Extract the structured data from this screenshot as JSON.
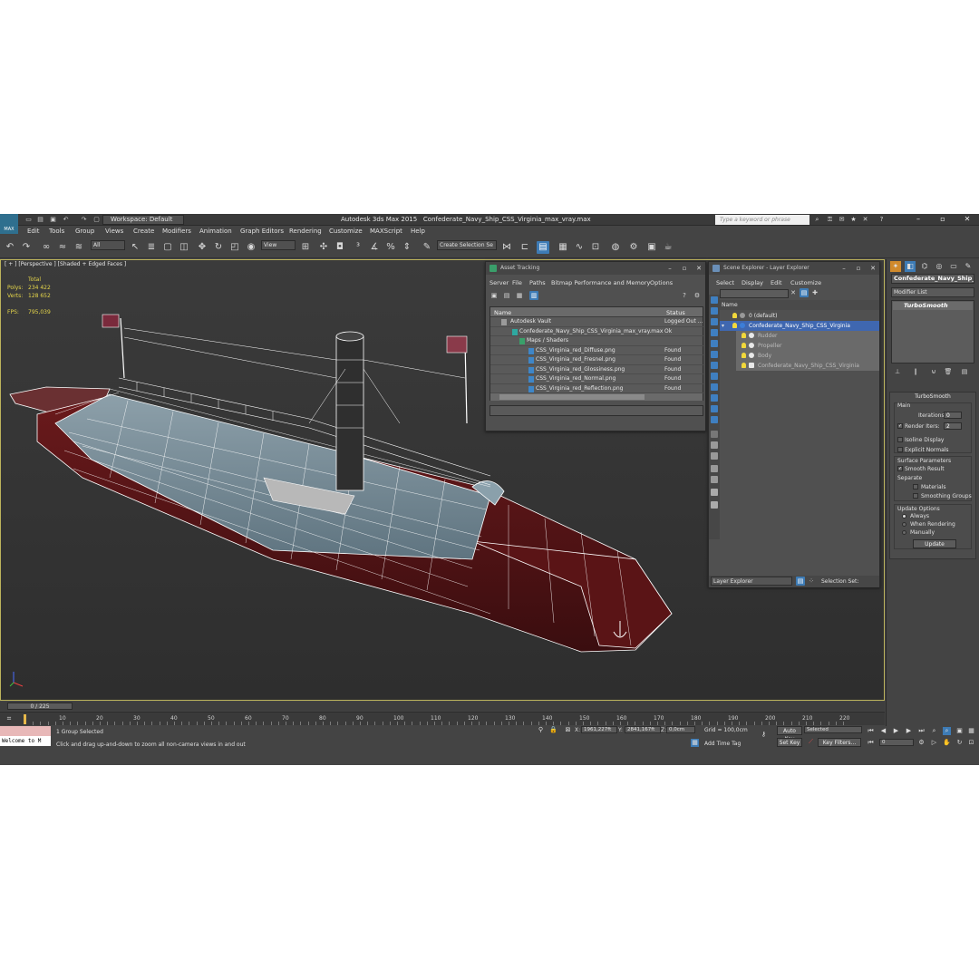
{
  "titlebar": {
    "workspace": "Workspace: Default",
    "app": "Autodesk 3ds Max  2015",
    "file": "Confederate_Navy_Ship_CSS_Virginia_max_vray.max",
    "search_placeholder": "Type a keyword or phrase"
  },
  "menu": [
    "Edit",
    "Tools",
    "Group",
    "Views",
    "Create",
    "Modifiers",
    "Animation",
    "Graph Editors",
    "Rendering",
    "Customize",
    "MAXScript",
    "Help"
  ],
  "toolbar": {
    "filter": "All",
    "ref_coord": "View",
    "selection_set": "Create Selection Se"
  },
  "viewport": {
    "label": "[ + ] [Perspective ] [Shaded + Edged Faces ]",
    "stats_header": "Total",
    "polys_label": "Polys:",
    "polys": "234 422",
    "verts_label": "Verts:",
    "verts": "128 652",
    "fps_label": "FPS:",
    "fps": "795,039"
  },
  "asset_tracking": {
    "title": "Asset Tracking",
    "menu": [
      "Server",
      "File",
      "Paths",
      "Bitmap Performance and Memory",
      "Options"
    ],
    "col_name": "Name",
    "col_status": "Status",
    "rows": [
      {
        "name": "Autodesk Vault",
        "status": "Logged Out ..."
      },
      {
        "name": "Confederate_Navy_Ship_CSS_Virginia_max_vray.max",
        "status": "Ok"
      },
      {
        "name": "Maps / Shaders",
        "status": ""
      },
      {
        "name": "CSS_Virginia_red_Diffuse.png",
        "status": "Found"
      },
      {
        "name": "CSS_Virginia_red_Fresnel.png",
        "status": "Found"
      },
      {
        "name": "CSS_Virginia_red_Glossiness.png",
        "status": "Found"
      },
      {
        "name": "CSS_Virginia_red_Normal.png",
        "status": "Found"
      },
      {
        "name": "CSS_Virginia_red_Reflection.png",
        "status": "Found"
      }
    ]
  },
  "scene_explorer": {
    "title": "Scene Explorer - Layer Explorer",
    "menu": [
      "Select",
      "Display",
      "Edit",
      "Customize"
    ],
    "col_name": "Name",
    "rows": [
      "0 (default)",
      "Confederate_Navy_Ship_CSS_Virginia",
      "Rudder",
      "Propeller",
      "Body",
      "Confederate_Navy_Ship_CSS_Virginia"
    ],
    "footer_left": "Layer Explorer",
    "footer_right": "Selection Set:"
  },
  "command_panel": {
    "object_name": "Confederate_Navy_Ship_",
    "modifier_list": "Modifier List",
    "stack_item": "TurboSmooth",
    "rollout_title": "TurboSmooth",
    "main_label": "Main",
    "iterations_label": "Iterations:",
    "iterations": "0",
    "render_iters_label": "Render Iters:",
    "render_iters": "2",
    "isoline": "Isoline Display",
    "explicit": "Explicit Normals",
    "surface_params": "Surface Parameters",
    "smooth_result": "Smooth Result",
    "separate": "Separate",
    "materials": "Materials",
    "smoothing_groups": "Smoothing Groups",
    "update_options": "Update Options",
    "always": "Always",
    "when_rendering": "When Rendering",
    "manually": "Manually",
    "update": "Update"
  },
  "timeline": {
    "frame": "0 / 225",
    "ticks": [
      "10",
      "20",
      "30",
      "40",
      "50",
      "60",
      "70",
      "80",
      "90",
      "100",
      "110",
      "120",
      "130",
      "140",
      "150",
      "160",
      "170",
      "180",
      "190",
      "200",
      "210",
      "220"
    ]
  },
  "status": {
    "maxscript": "Welcome to M",
    "selection": "1 Group Selected",
    "prompt": "Click and drag up-and-down to zoom all non-camera views in and out",
    "x_label": "X:",
    "x": "1961,227ft",
    "y_label": "Y:",
    "y": "2841,167ft",
    "z_label": "Z:",
    "z": "0,0cm",
    "grid": "Grid = 100,0cm",
    "add_time_tag": "Add Time Tag",
    "auto_key": "Auto Key",
    "key_mode": "Selected",
    "set_key": "Set Key",
    "key_filters": "Key Filters...",
    "frame_field": "0"
  }
}
